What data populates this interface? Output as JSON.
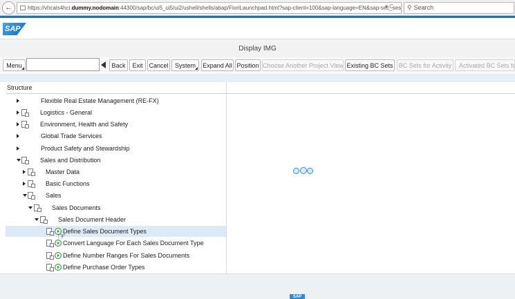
{
  "browser": {
    "back_icon": "back-arrow-icon",
    "url_prefix": "https://vhcals4hci.",
    "url_host": "dummy.nodomain",
    "url_rest": ":44300/sap/bc/ui5_ui5/ui2/ushell/shells/abap/FioriLaunchpad.html?sap-client=100&sap-language=EN&sap-sec_session_created=X",
    "url_controls": "▾ C",
    "search_placeholder": "Search"
  },
  "shell": {
    "logo_text": "SAP",
    "title": "Display IMG",
    "accent_color": "#1a73b8"
  },
  "toolbar": {
    "menu": "Menu",
    "command_value": "",
    "back": "Back",
    "exit": "Exit",
    "cancel": "Cancel",
    "system": "System",
    "expand_all": "Expand All",
    "position": "Position",
    "choose_project_view": "Choose Another Project View",
    "existing_bc_sets": "Existing BC Sets",
    "bc_sets_activity": "BC Sets for Activity",
    "activated_bc_sets": "Activated BC Sets for"
  },
  "structure": {
    "header": "Structure",
    "items": [
      {
        "label": "Flexible Real Estate Management (RE-FX)",
        "state": "collapsed",
        "has_doc": false,
        "has_exec": false
      },
      {
        "label": "Logistics - General",
        "state": "collapsed",
        "has_doc": true,
        "has_exec": false
      },
      {
        "label": "Environment, Health and Safety",
        "state": "collapsed",
        "has_doc": true,
        "has_exec": false
      },
      {
        "label": "Global Trade Services",
        "state": "collapsed",
        "has_doc": false,
        "has_exec": false
      },
      {
        "label": "Product Safety and Stewardship",
        "state": "collapsed",
        "has_doc": false,
        "has_exec": false
      },
      {
        "label": "Sales and Distribution",
        "state": "expanded",
        "has_doc": true,
        "has_exec": false
      },
      {
        "label": "Master Data",
        "state": "collapsed",
        "has_doc": true,
        "has_exec": false
      },
      {
        "label": "Basic Functions",
        "state": "collapsed",
        "has_doc": true,
        "has_exec": false
      },
      {
        "label": "Sales",
        "state": "expanded",
        "has_doc": true,
        "has_exec": false
      },
      {
        "label": "Sales Documents",
        "state": "expanded",
        "has_doc": true,
        "has_exec": false
      },
      {
        "label": "Sales Document Header",
        "state": "expanded",
        "has_doc": true,
        "has_exec": false
      },
      {
        "label": "Define Sales Document Types",
        "state": "leaf",
        "has_doc": true,
        "has_exec": true,
        "selected": true
      },
      {
        "label": "Convert Language For Each Sales Document Type",
        "state": "leaf",
        "has_doc": true,
        "has_exec": true
      },
      {
        "label": "Define Number Ranges For Sales Documents",
        "state": "leaf",
        "has_doc": true,
        "has_exec": true
      },
      {
        "label": "Define Purchase Order Types",
        "state": "leaf",
        "has_doc": true,
        "has_exec": true
      }
    ]
  },
  "footer": {
    "logo_text": "SAP"
  }
}
